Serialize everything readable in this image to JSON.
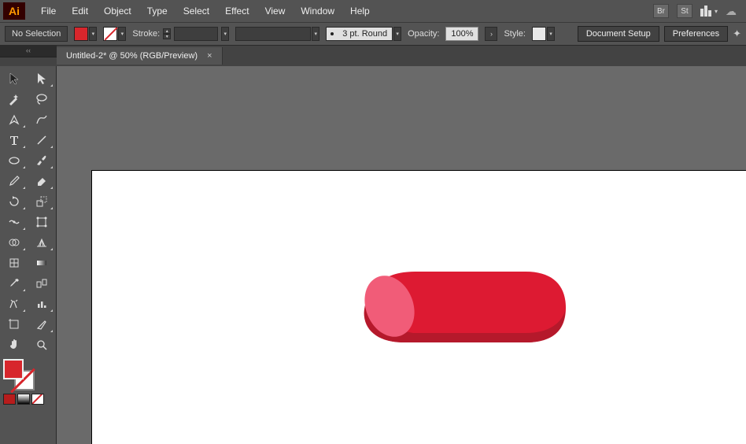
{
  "app": {
    "logo": "Ai"
  },
  "menu": [
    "File",
    "Edit",
    "Object",
    "Type",
    "Select",
    "Effect",
    "View",
    "Window",
    "Help"
  ],
  "menu_right": {
    "br": "Br",
    "st": "St"
  },
  "control": {
    "selection": "No Selection",
    "stroke_label": "Stroke:",
    "brush_label": "3 pt. Round",
    "opacity_label": "Opacity:",
    "opacity_value": "100%",
    "style_label": "Style:",
    "doc_setup": "Document Setup",
    "preferences": "Preferences"
  },
  "tab": {
    "title": "Untitled-2* @ 50% (RGB/Preview)",
    "close": "×"
  },
  "tab_handle": "‹‹",
  "colors": {
    "fill": "#d7262c",
    "shape_main": "#dd1a32",
    "shape_light": "#f15c78",
    "shape_dark": "#b5192b"
  }
}
